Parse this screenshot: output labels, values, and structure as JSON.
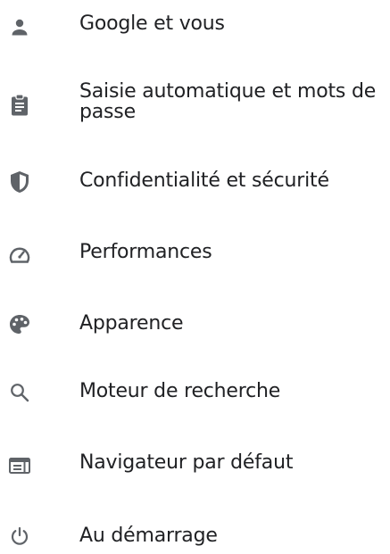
{
  "menu": {
    "items": [
      {
        "label": "Google et vous",
        "icon": "person-icon"
      },
      {
        "label": "Saisie automatique et mots de passe",
        "icon": "clipboard-icon"
      },
      {
        "label": "Confidentialité et sécurité",
        "icon": "shield-icon"
      },
      {
        "label": "Performances",
        "icon": "speedometer-icon"
      },
      {
        "label": "Apparence",
        "icon": "palette-icon"
      },
      {
        "label": "Moteur de recherche",
        "icon": "search-icon"
      },
      {
        "label": "Navigateur par défaut",
        "icon": "browser-icon"
      },
      {
        "label": "Au démarrage",
        "icon": "power-icon"
      }
    ]
  },
  "colors": {
    "text": "#202124",
    "icon": "#5f6368"
  }
}
